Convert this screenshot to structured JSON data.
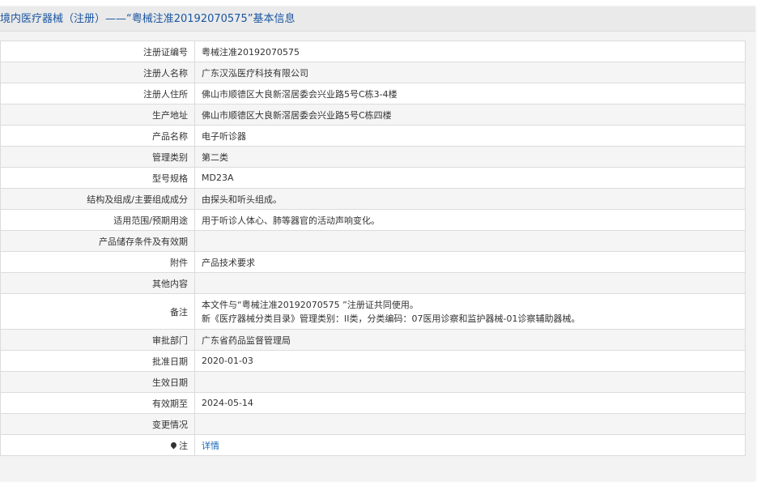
{
  "title": "境内医疗器械（注册）——“粤械注准20192070575”基本信息",
  "rows": [
    {
      "label": "注册证编号",
      "value": "粤械注准20192070575"
    },
    {
      "label": "注册人名称",
      "value": "广东汉泓医疗科技有限公司"
    },
    {
      "label": "注册人住所",
      "value": "佛山市顺德区大良新滘居委会兴业路5号C栋3-4楼"
    },
    {
      "label": "生产地址",
      "value": "佛山市顺德区大良新滘居委会兴业路5号C栋四楼"
    },
    {
      "label": "产品名称",
      "value": "电子听诊器"
    },
    {
      "label": "管理类别",
      "value": "第二类"
    },
    {
      "label": "型号规格",
      "value": "MD23A"
    },
    {
      "label": "结构及组成/主要组成成分",
      "value": "由探头和听头组成。"
    },
    {
      "label": "适用范围/预期用途",
      "value": "用于听诊人体心、肺等器官的活动声响变化。"
    },
    {
      "label": "产品储存条件及有效期",
      "value": ""
    },
    {
      "label": "附件",
      "value": "产品技术要求"
    },
    {
      "label": "其他内容",
      "value": ""
    },
    {
      "label": "备注",
      "value_lines": [
        "本文件与“粤械注准20192070575 ”注册证共同使用。",
        "新《医疗器械分类目录》管理类别：II类，分类编码：07医用诊察和监护器械-01诊察辅助器械。"
      ]
    },
    {
      "label": "审批部门",
      "value": "广东省药品监督管理局"
    },
    {
      "label": "批准日期",
      "value": "2020-01-03"
    },
    {
      "label": "生效日期",
      "value": ""
    },
    {
      "label": "有效期至",
      "value": "2024-05-14"
    },
    {
      "label": "变更情况",
      "value": ""
    },
    {
      "label": "注",
      "icon": "location-pin-icon",
      "link": "详情"
    }
  ]
}
